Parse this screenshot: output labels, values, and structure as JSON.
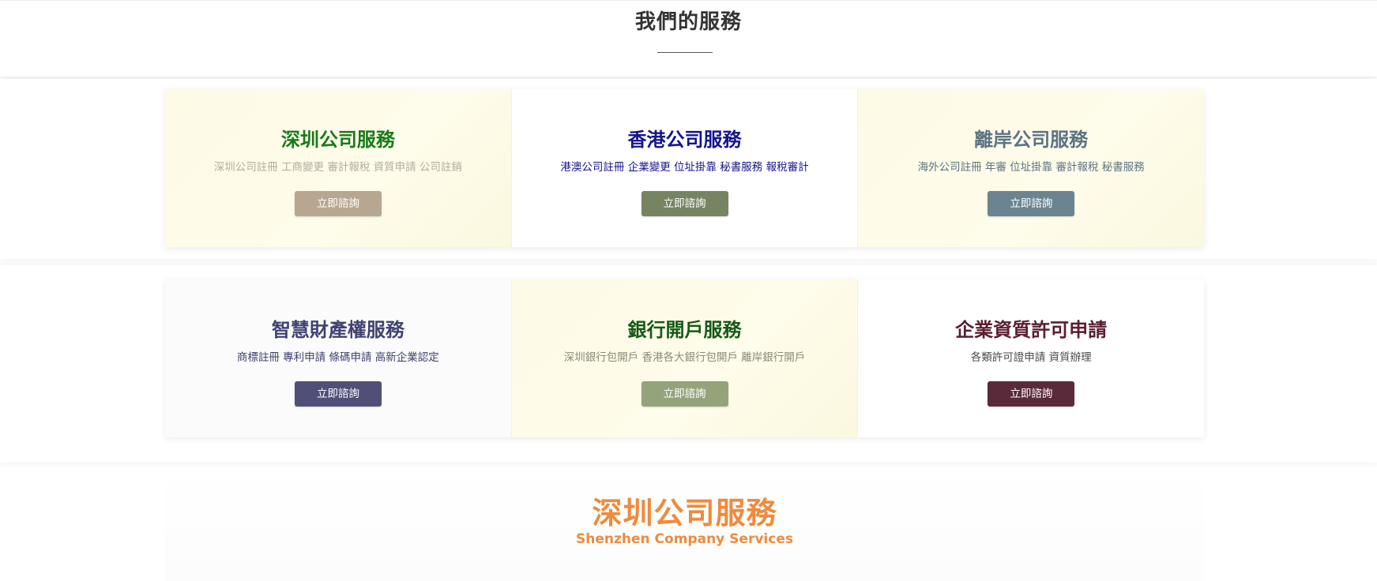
{
  "header": {
    "title": "我們的服務"
  },
  "rows": [
    {
      "cards": [
        {
          "title": "深圳公司服務",
          "description": "深圳公司註冊 工商變更 審計報稅 資質申請 公司註銷",
          "button_label": "立即諮詢",
          "title_color": "#1a7a1a",
          "desc_color": "#b5ab9e",
          "button_color": "#b8a790"
        },
        {
          "title": "香港公司服務",
          "description": "港澳公司註冊 企業變更 位址掛靠 秘書服務 報稅審計",
          "button_label": "立即諮詢",
          "title_color": "#14148c",
          "desc_color": "#14148c",
          "button_color": "#778462"
        },
        {
          "title": "離岸公司服務",
          "description": "海外公司註冊 年審 位址掛靠 審計報稅 秘書服務",
          "button_label": "立即諮詢",
          "title_color": "#5c7382",
          "desc_color": "#5c7382",
          "button_color": "#6a8591"
        }
      ]
    },
    {
      "cards": [
        {
          "title": "智慧財產權服務",
          "description": "商標註冊 專利申請 條碼申請 高新企業認定",
          "button_label": "立即諮詢",
          "title_color": "#3f4370",
          "desc_color": "#3f4370",
          "button_color": "#4f4f78"
        },
        {
          "title": "銀行開戶服務",
          "description": "深圳銀行包開戶 香港各大銀行包開戶 離岸銀行開戶",
          "button_label": "立即諮詢",
          "title_color": "#155a15",
          "desc_color": "#8a8a7a",
          "button_color": "#93a47a"
        },
        {
          "title": "企業資質許可申請",
          "description": "各類許可證申請 資質辦理",
          "button_label": "立即諮詢",
          "title_color": "#5a1e30",
          "desc_color": "#4a4a4a",
          "button_color": "#5a2a3a"
        }
      ]
    }
  ],
  "bottom": {
    "title": "深圳公司服務",
    "subtitle": "Shenzhen Company Services",
    "color": "#f08a3c"
  }
}
